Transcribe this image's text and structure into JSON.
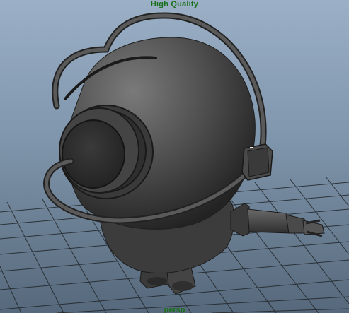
{
  "viewport": {
    "renderer_label": "High Quality",
    "camera_label": "persp",
    "background_top": "#9bb0c6",
    "background_bottom": "#56687b",
    "grid_color": "#202428",
    "model_color": "#4a4a4a",
    "hud_text_color": "#1a6f1a"
  }
}
